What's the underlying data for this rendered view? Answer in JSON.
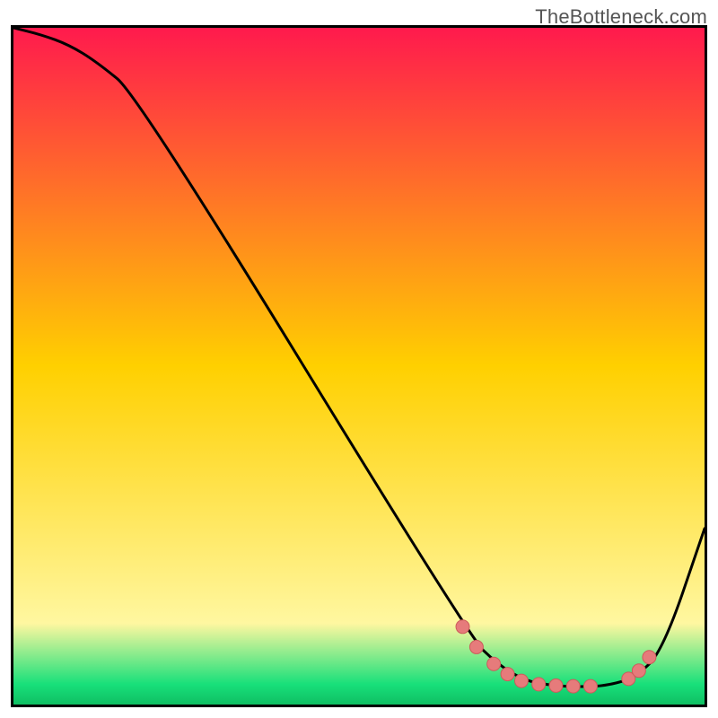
{
  "watermark": "TheBottleneck.com",
  "colors": {
    "stroke": "#000000",
    "gradient_top": "#ff1a4d",
    "gradient_mid": "#ffd000",
    "gradient_low": "#fff7a0",
    "gradient_bottom": "#18e07a",
    "dot_fill": "#e67b7b",
    "dot_stroke": "#cc5b5b"
  },
  "chart_data": {
    "type": "line",
    "title": "",
    "xlabel": "",
    "ylabel": "",
    "xlim": [
      0,
      100
    ],
    "ylim": [
      0,
      100
    ],
    "background_gradient_stops": [
      {
        "offset": 0.0,
        "value": 100,
        "color": "#ff1a4d"
      },
      {
        "offset": 0.5,
        "value": 50,
        "color": "#ffd000"
      },
      {
        "offset": 0.88,
        "value": 12,
        "color": "#fff7a0"
      },
      {
        "offset": 0.97,
        "value": 3,
        "color": "#18e07a"
      },
      {
        "offset": 1.0,
        "value": 0,
        "color": "#0fbf63"
      }
    ],
    "series": [
      {
        "name": "bottleneck-curve",
        "x": [
          0,
          4,
          8,
          12,
          18,
          66,
          70,
          74,
          78,
          82,
          86,
          90,
          94,
          100
        ],
        "values": [
          100,
          99,
          97.5,
          95,
          90,
          10,
          6,
          3.5,
          2.8,
          2.6,
          2.8,
          4,
          8,
          26
        ]
      }
    ],
    "dots": {
      "name": "highlight-dots",
      "x": [
        65,
        67,
        69.5,
        71.5,
        73.5,
        76,
        78.5,
        81,
        83.5,
        89,
        90.5,
        92
      ],
      "values": [
        11.5,
        8.5,
        6,
        4.5,
        3.5,
        3,
        2.8,
        2.7,
        2.7,
        3.8,
        5,
        7
      ]
    }
  }
}
